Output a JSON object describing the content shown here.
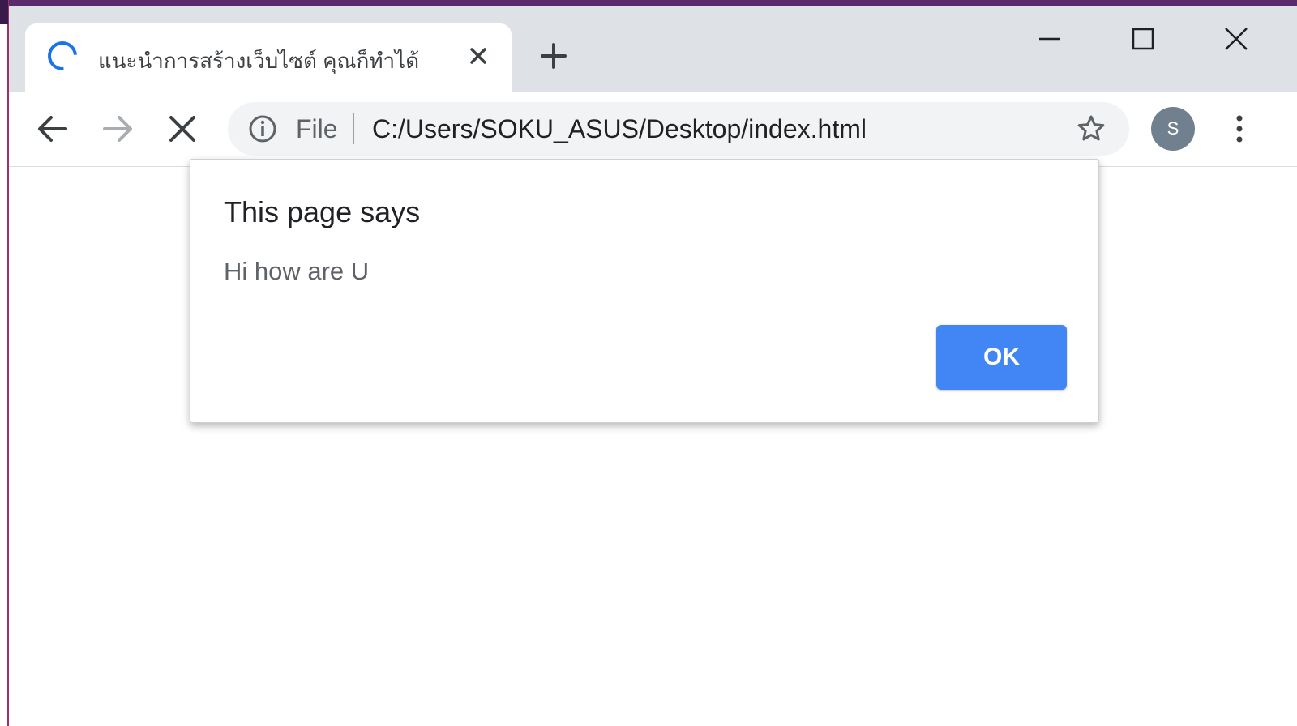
{
  "tab": {
    "title": "แนะนำการสร้างเว็บไซต์ คุณก็ทำได้"
  },
  "omnibox": {
    "scheme_chip": "File",
    "url": "C:/Users/SOKU_ASUS/Desktop/index.html"
  },
  "profile": {
    "initial": "S"
  },
  "dialog": {
    "title": "This page says",
    "message": "Hi how are U",
    "ok_label": "OK"
  },
  "icons": [
    "loading-spinner-icon",
    "close-icon",
    "plus-icon",
    "minimize-icon",
    "maximize-icon",
    "window-close-icon",
    "back-arrow-icon",
    "forward-arrow-icon",
    "stop-icon",
    "info-icon",
    "star-icon",
    "more-vert-icon"
  ],
  "colors": {
    "tabstrip": "#dee1e6",
    "accent": "#1a73e8",
    "ok_button": "#4285f4",
    "avatar": "#70808e",
    "omnibox": "#f1f3f4"
  }
}
